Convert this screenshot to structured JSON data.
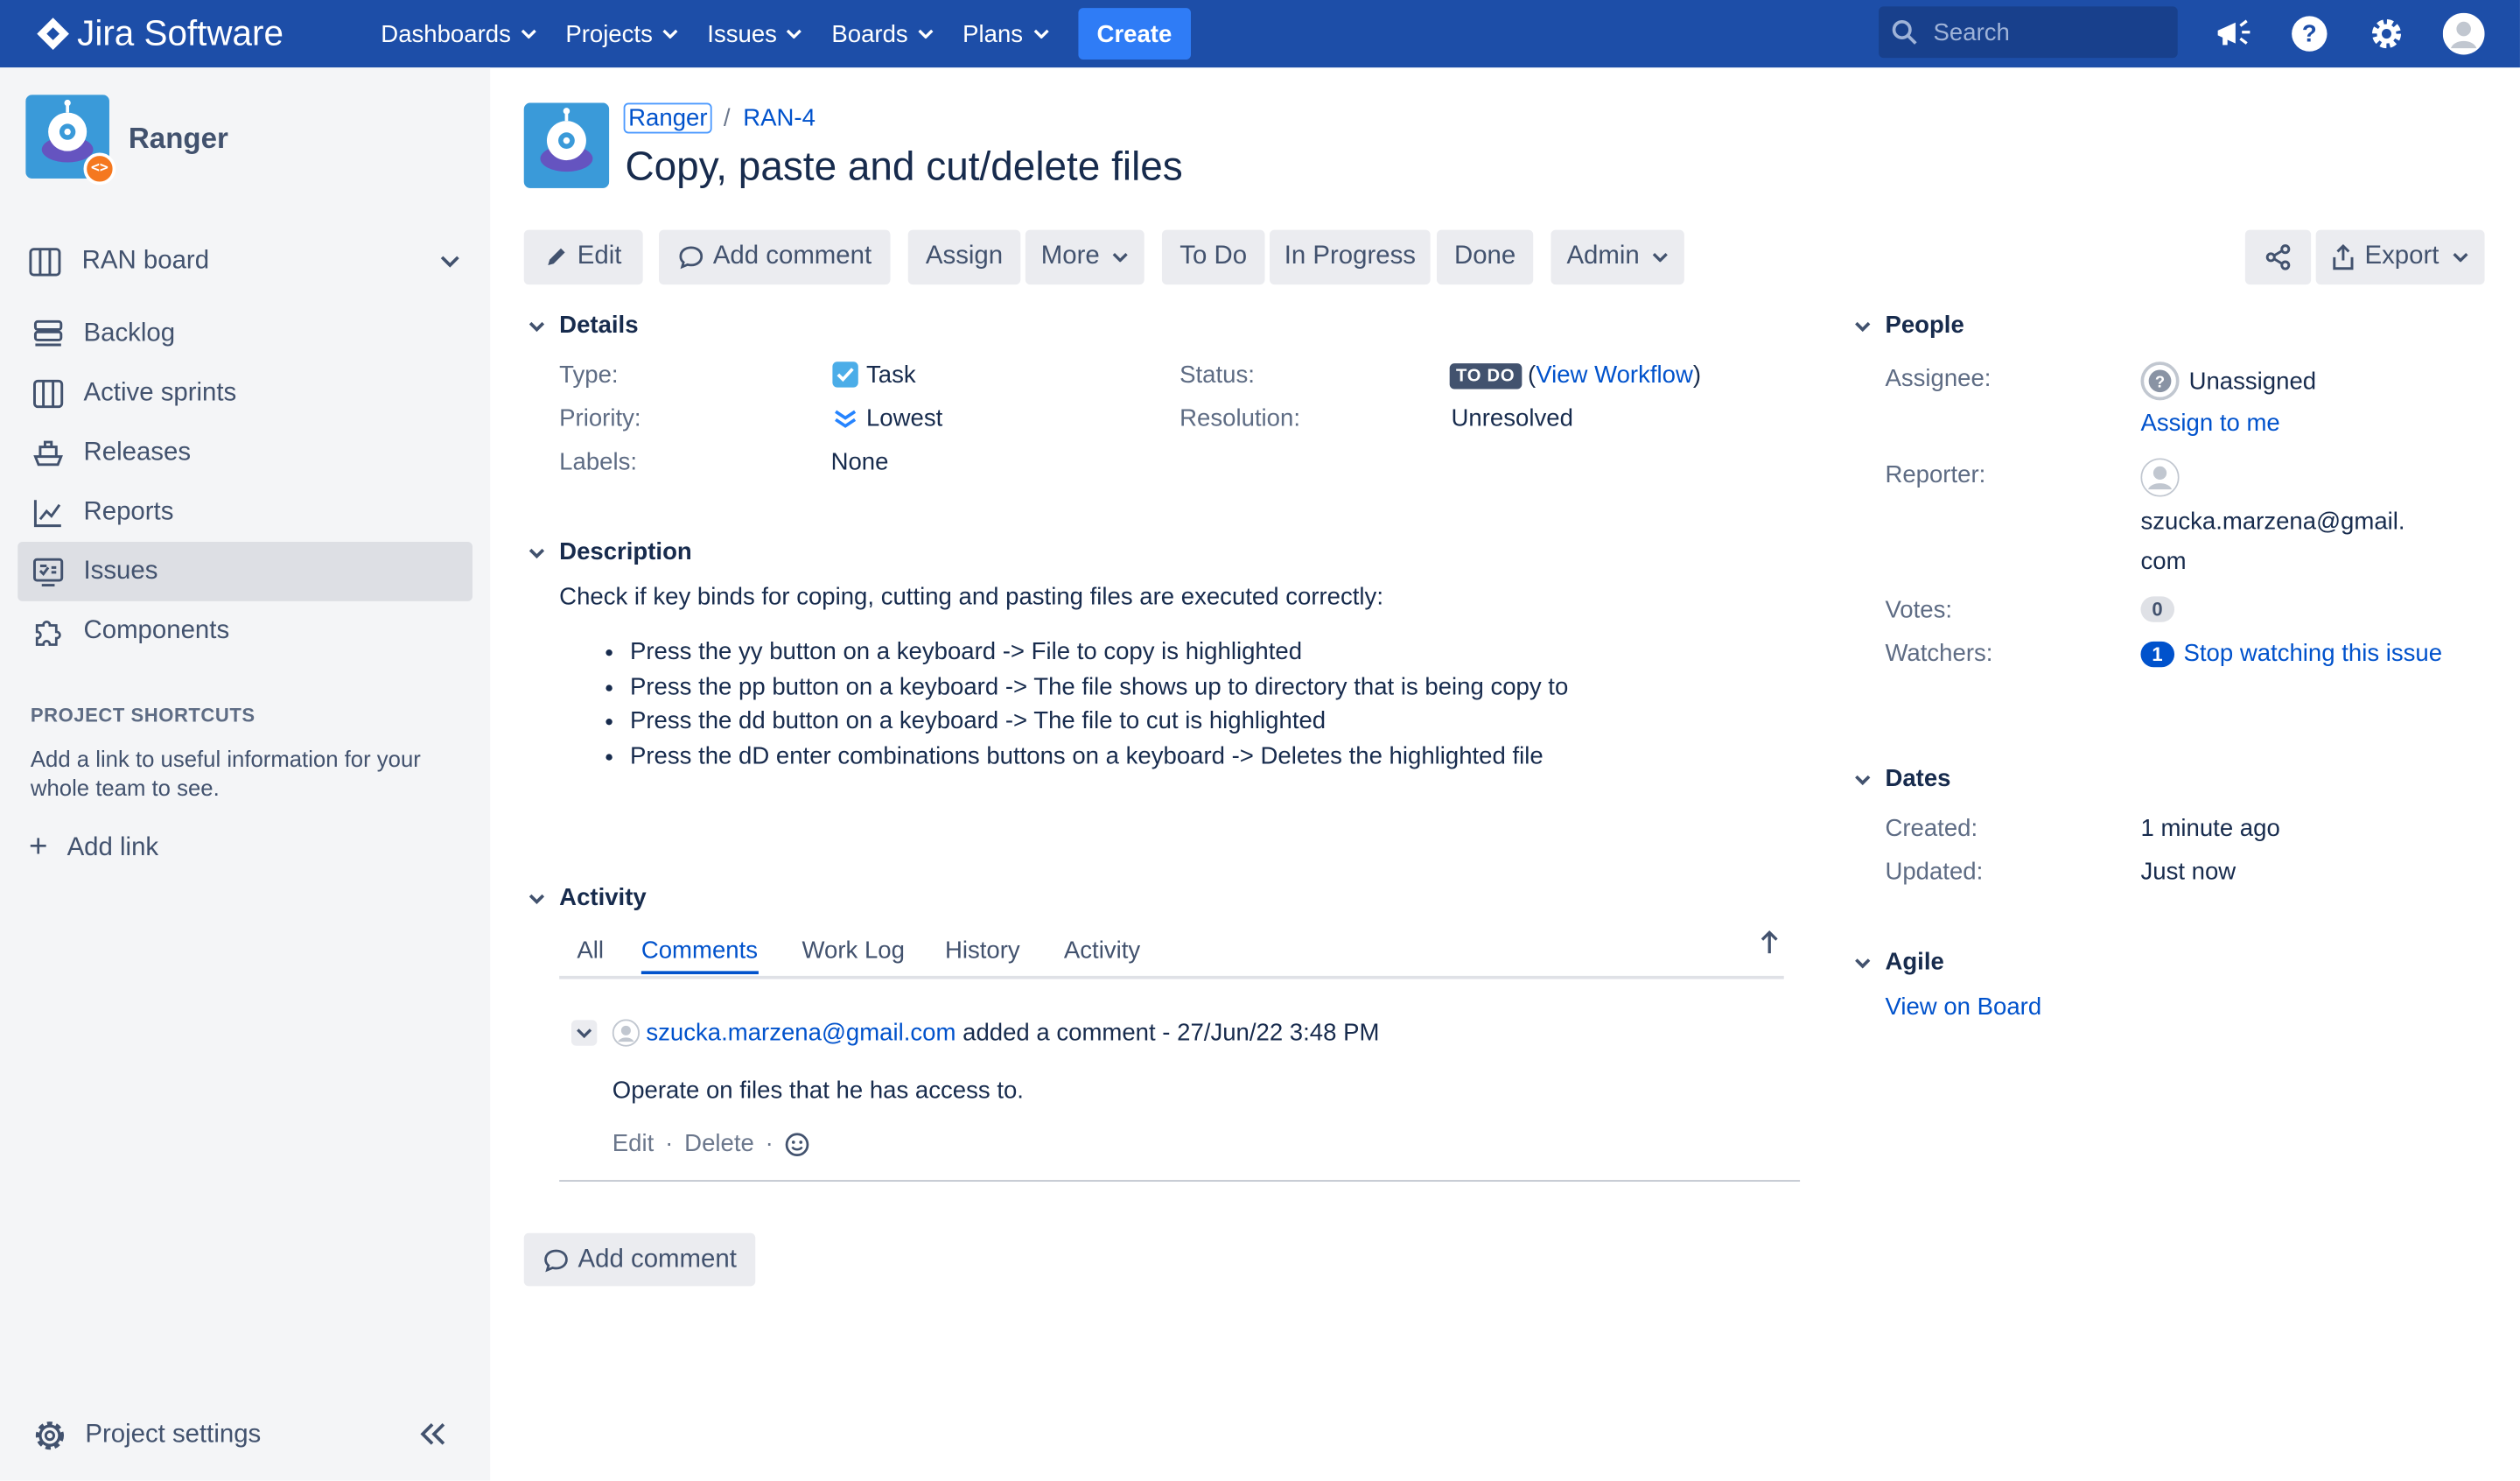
{
  "topnav": {
    "product": "Jira Software",
    "items": [
      {
        "label": "Dashboards"
      },
      {
        "label": "Projects"
      },
      {
        "label": "Issues"
      },
      {
        "label": "Boards"
      },
      {
        "label": "Plans"
      }
    ],
    "create_label": "Create",
    "search_placeholder": "Search"
  },
  "sidebar": {
    "project_name": "Ranger",
    "board_label": "RAN board",
    "items": [
      {
        "label": "Backlog"
      },
      {
        "label": "Active sprints"
      },
      {
        "label": "Releases"
      },
      {
        "label": "Reports"
      },
      {
        "label": "Issues"
      },
      {
        "label": "Components"
      }
    ],
    "shortcuts_title": "PROJECT SHORTCUTS",
    "shortcuts_text": "Add a link to useful information for your whole team to see.",
    "add_link": "Add link",
    "project_settings": "Project settings"
  },
  "issue": {
    "breadcrumb_project": "Ranger",
    "breadcrumb_key": "RAN-4",
    "title": "Copy, paste and cut/delete files"
  },
  "toolbar": {
    "edit": "Edit",
    "add_comment": "Add comment",
    "assign": "Assign",
    "more": "More",
    "todo": "To Do",
    "in_progress": "In Progress",
    "done": "Done",
    "admin": "Admin",
    "export": "Export"
  },
  "details": {
    "heading": "Details",
    "type_label": "Type:",
    "type_value": "Task",
    "priority_label": "Priority:",
    "priority_value": "Lowest",
    "labels_label": "Labels:",
    "labels_value": "None",
    "status_label": "Status:",
    "status_value": "TO DO",
    "view_workflow": "View Workflow",
    "resolution_label": "Resolution:",
    "resolution_value": "Unresolved"
  },
  "description": {
    "heading": "Description",
    "intro": "Check if key binds for coping, cutting and pasting files are executed correctly:",
    "items": [
      "Press the yy button on a keyboard -> File to copy is highlighted",
      "Press the pp button on a keyboard -> The file shows up to directory that is being copy to",
      "Press the dd button on a keyboard -> The file to cut is highlighted",
      "Press the dD enter combinations buttons on a keyboard -> Deletes the highlighted file"
    ]
  },
  "activity": {
    "heading": "Activity",
    "tabs": [
      "All",
      "Comments",
      "Work Log",
      "History",
      "Activity"
    ],
    "comment": {
      "author": "szucka.marzena@gmail.com",
      "meta": " added a comment - 27/Jun/22 3:48 PM",
      "body": "Operate on files that he has access to.",
      "edit": "Edit",
      "delete": "Delete"
    },
    "add_comment": "Add comment"
  },
  "people": {
    "heading": "People",
    "assignee_label": "Assignee:",
    "assignee_value": "Unassigned",
    "assign_to_me": "Assign to me",
    "reporter_label": "Reporter:",
    "reporter_line1": "szucka.marzena@gmail.",
    "reporter_line2": "com",
    "votes_label": "Votes:",
    "votes_value": "0",
    "watchers_label": "Watchers:",
    "watchers_count": "1",
    "watchers_link": "Stop watching this issue"
  },
  "dates": {
    "heading": "Dates",
    "created_label": "Created:",
    "created_value": "1 minute ago",
    "updated_label": "Updated:",
    "updated_value": "Just now"
  },
  "agile": {
    "heading": "Agile",
    "view_on_board": "View on Board"
  }
}
